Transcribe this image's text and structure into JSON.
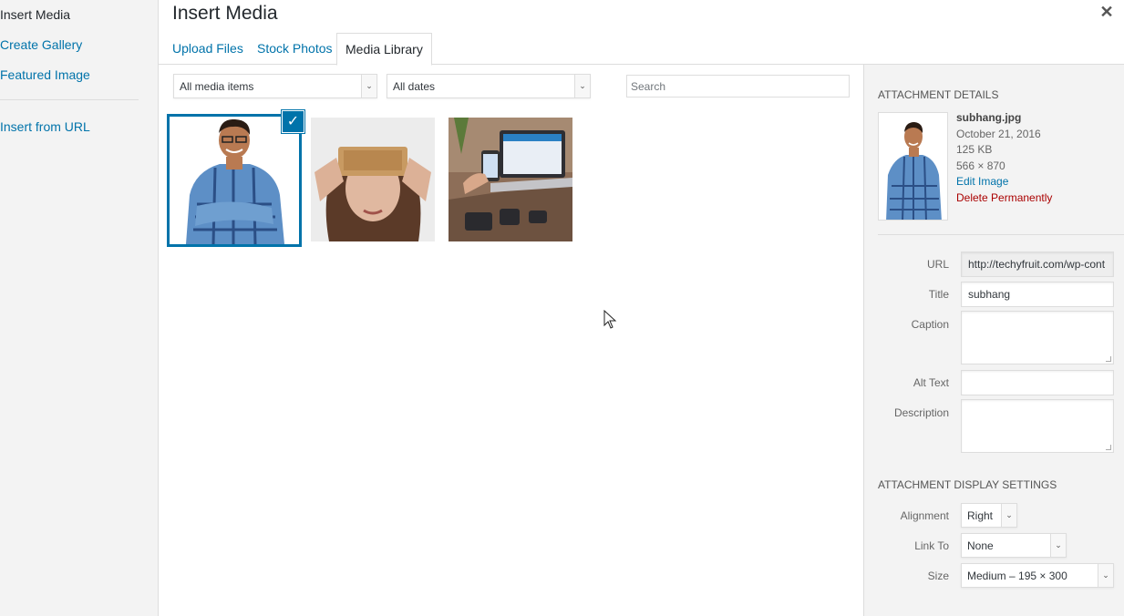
{
  "sidebar": {
    "items": [
      {
        "label": "Insert Media"
      },
      {
        "label": "Create Gallery"
      },
      {
        "label": "Featured Image"
      },
      {
        "label": "Insert from URL"
      }
    ]
  },
  "header": {
    "title": "Insert Media",
    "close_icon": "close-icon"
  },
  "tabs": [
    {
      "label": "Upload Files"
    },
    {
      "label": "Stock Photos"
    },
    {
      "label": "Media Library"
    }
  ],
  "toolbar": {
    "filter_type": "All media items",
    "filter_date": "All dates",
    "search_placeholder": "Search"
  },
  "attachment_details": {
    "heading": "ATTACHMENT DETAILS",
    "filename": "subhang.jpg",
    "date": "October 21, 2016",
    "size": "125 KB",
    "dimensions": "566 × 870",
    "edit_link": "Edit Image",
    "delete_link": "Delete Permanently",
    "fields": {
      "url_label": "URL",
      "url_value": "http://techyfruit.com/wp-cont",
      "title_label": "Title",
      "title_value": "subhang",
      "caption_label": "Caption",
      "alt_label": "Alt Text",
      "description_label": "Description"
    }
  },
  "display_settings": {
    "heading": "ATTACHMENT DISPLAY SETTINGS",
    "alignment_label": "Alignment",
    "alignment_value": "Right",
    "link_label": "Link To",
    "link_value": "None",
    "size_label": "Size",
    "size_value": "Medium – 195 × 300"
  },
  "colors": {
    "accent": "#0073aa",
    "danger": "#a00000",
    "panel_bg": "#f3f3f3"
  }
}
